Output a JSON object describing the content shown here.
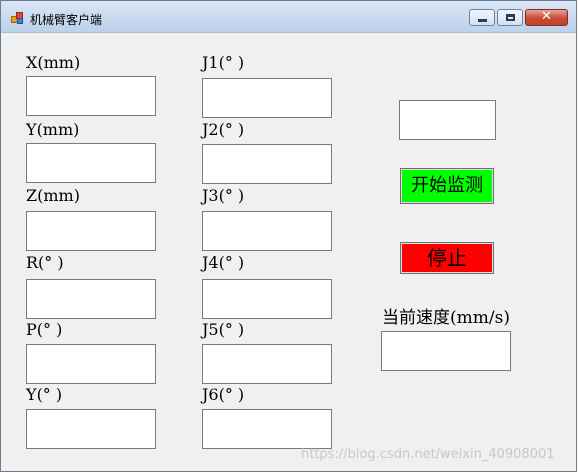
{
  "window": {
    "title": "机械臂客户端",
    "controls": {
      "minimize": "minimize",
      "maximize": "maximize",
      "close": "✕"
    }
  },
  "cartesian": {
    "x_label": "X(mm)",
    "y_label": "Y(mm)",
    "z_label": "Z(mm)",
    "r_label": "R(° )",
    "p_label": "P(° )",
    "yaw_label": "Y(° )"
  },
  "joints": {
    "j1_label": "J1(° )",
    "j2_label": "J2(° )",
    "j3_label": "J3(° )",
    "j4_label": "J4(° )",
    "j5_label": "J5(° )",
    "j6_label": "J6(° )"
  },
  "inputs": {
    "x": "",
    "y": "",
    "z": "",
    "r": "",
    "p": "",
    "yaw": "",
    "j1": "",
    "j2": "",
    "j3": "",
    "j4": "",
    "j5": "",
    "j6": "",
    "top_right": "",
    "speed": ""
  },
  "buttons": {
    "start_label": "开始监测",
    "stop_label": "停止"
  },
  "speed": {
    "label": "当前速度(mm/s)"
  },
  "watermark": "https://blog.csdn.net/weixin_40908001",
  "colors": {
    "start_button": "#00ff00",
    "stop_button": "#ff0000",
    "window_bg": "#f0f0f0"
  }
}
